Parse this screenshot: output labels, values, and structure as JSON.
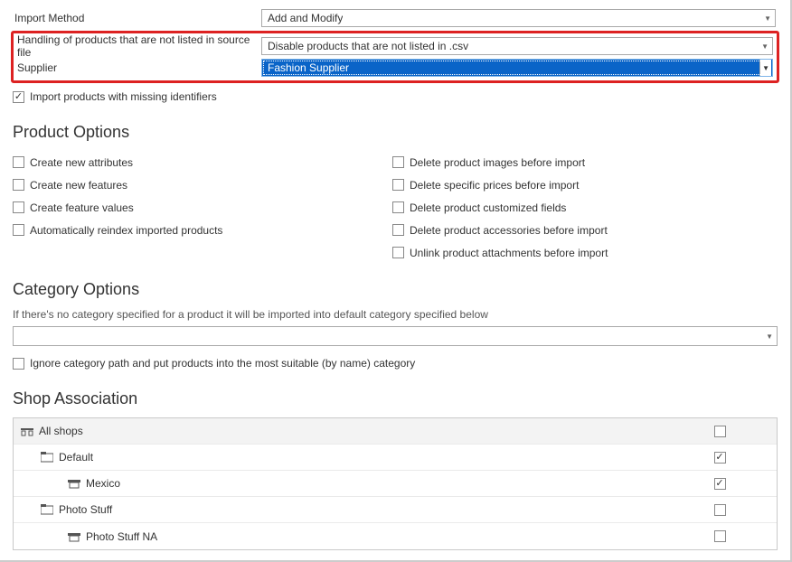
{
  "form": {
    "import_method": {
      "label": "Import Method",
      "value": "Add and Modify"
    },
    "handling": {
      "label": "Handling of products that are not listed in source file",
      "value": "Disable products that are not listed in .csv"
    },
    "supplier": {
      "label": "Supplier",
      "value": "Fashion Supplier"
    },
    "import_missing": {
      "label": "Import products with missing identifiers"
    }
  },
  "sections": {
    "product_options": "Product Options",
    "category_options": "Category Options",
    "shop_association": "Shop Association"
  },
  "product_options_left": [
    "Create new attributes",
    "Create new features",
    "Create feature values",
    "Automatically reindex imported products"
  ],
  "product_options_right": [
    "Delete product images before import",
    "Delete specific prices before import",
    "Delete product customized fields",
    "Delete product accessories before import",
    "Unlink product attachments before import"
  ],
  "category": {
    "help": "If there's no category specified for a product it will be imported into default category specified below",
    "ignore_path": "Ignore category path and put products into the most suitable (by name) category"
  },
  "shops": {
    "all": "All shops",
    "n1": "Default",
    "n1a": "Mexico",
    "n2": "Photo Stuff",
    "n2a": "Photo Stuff NA"
  }
}
